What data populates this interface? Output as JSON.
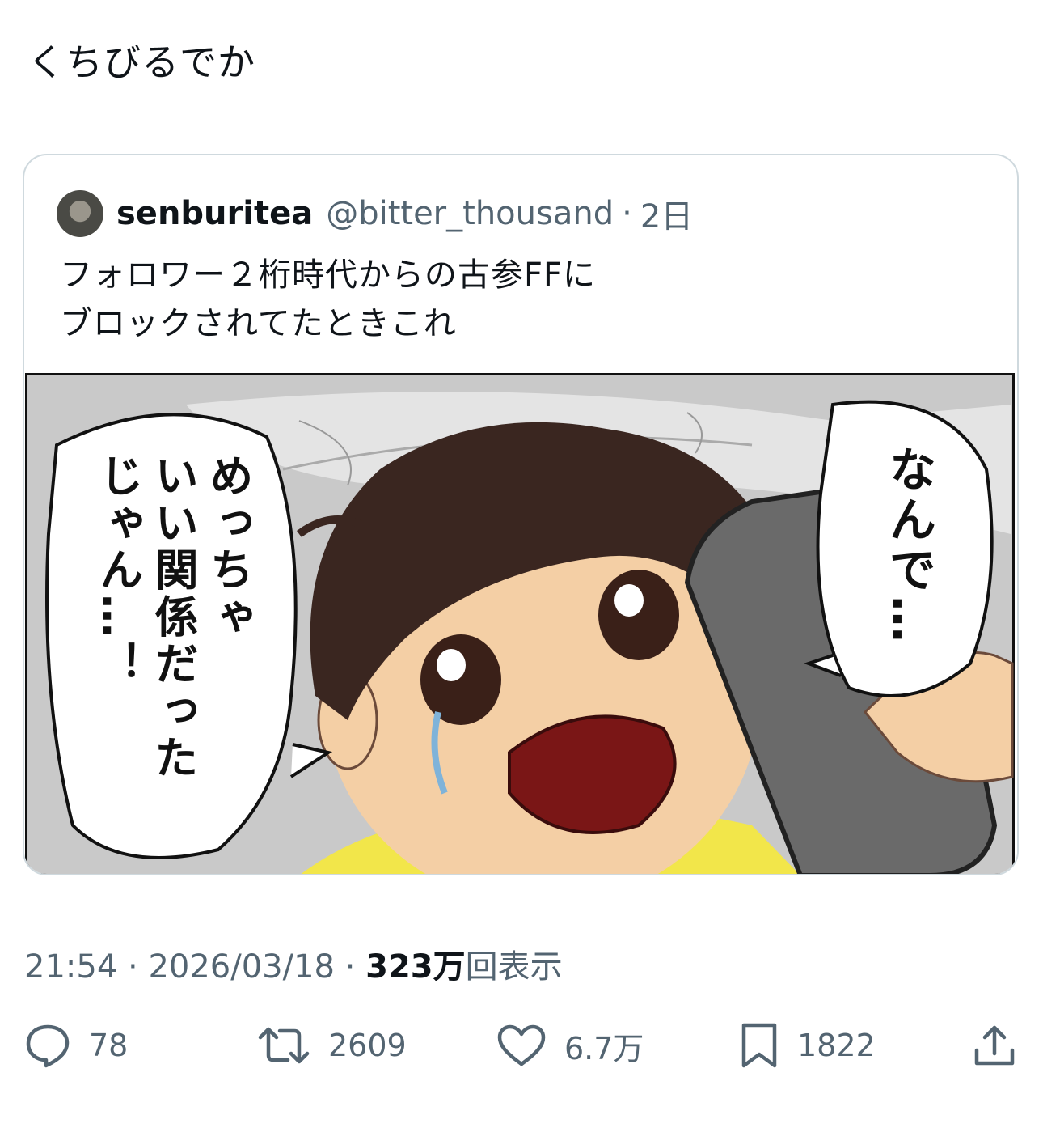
{
  "tweet": {
    "text": "くちびるでか",
    "timestamp": "21:54",
    "date": "2026/03/18",
    "views_count": "323万",
    "views_label": "回表示"
  },
  "quote": {
    "display_name": "senburitea",
    "handle": "@bitter_thousand",
    "age": "2日",
    "text_lines": [
      "フォロワー２桁時代からの古参FFに",
      "ブロックされてたときこれ"
    ],
    "bubble_right": "なんで…",
    "bubble_left": [
      "めっちゃ",
      "いい関係だった",
      "じゃん…！"
    ]
  },
  "actions": {
    "replies": "78",
    "retweets": "2609",
    "likes": "6.7万",
    "bookmarks": "1822"
  },
  "icons": [
    "reply-icon",
    "retweet-icon",
    "like-icon",
    "bookmark-icon",
    "share-icon"
  ],
  "colors": {
    "text": "#0f1419",
    "muted": "#536471",
    "border": "#cfd9de"
  }
}
